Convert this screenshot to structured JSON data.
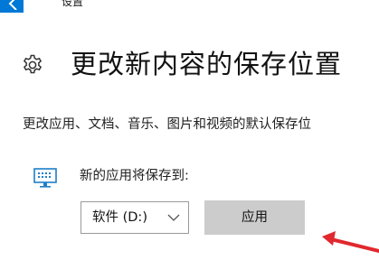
{
  "window": {
    "title": "设置"
  },
  "page": {
    "title": "更改新内容的保存位置",
    "description": "更改应用、文档、音乐、图片和视频的默认保存位",
    "icon": "gear-icon"
  },
  "apps_section": {
    "icon": "monitor-icon",
    "label": "新的应用将保存到:",
    "drive_value": "软件 (D:)",
    "apply_label": "应用"
  },
  "colors": {
    "accent": "#0078d7",
    "button_bg": "#cccccc",
    "annotation": "#e0282e"
  }
}
